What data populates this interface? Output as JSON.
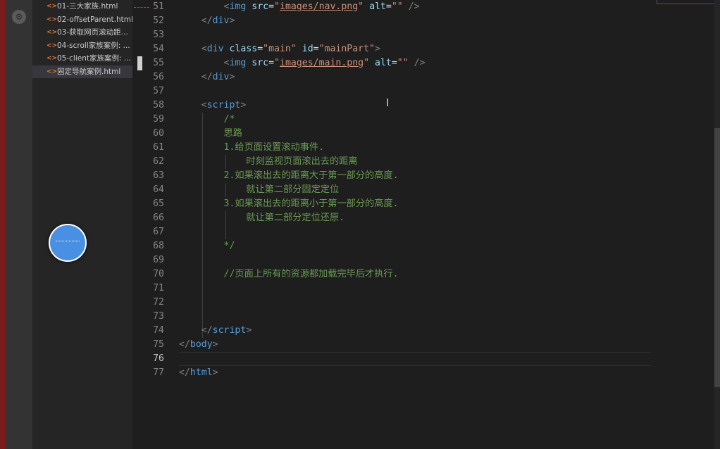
{
  "explorer": {
    "files": [
      {
        "icon": "<>",
        "name": "01-三大家族.html"
      },
      {
        "icon": "<>",
        "name": "02-offsetParent.html"
      },
      {
        "icon": "<>",
        "name": "03-获取网页滚动距..."
      },
      {
        "icon": "<>",
        "name": "04-scroll家族案例: ..."
      },
      {
        "icon": "<>",
        "name": "05-client家族案例: ..."
      },
      {
        "icon": "<>",
        "name": "固定导航案例.html",
        "active": true
      }
    ]
  },
  "editor": {
    "lines": [
      {
        "n": "51",
        "tokens": [
          [
            "",
            "        "
          ],
          [
            "bracket",
            "<"
          ],
          [
            "tag",
            "img"
          ],
          [
            "",
            " "
          ],
          [
            "attr",
            "src"
          ],
          [
            "",
            "="
          ],
          [
            "str",
            "\""
          ],
          [
            "str link",
            "images/nav.png"
          ],
          [
            "str",
            "\""
          ],
          [
            "",
            " "
          ],
          [
            "attr",
            "alt"
          ],
          [
            "",
            "="
          ],
          [
            "str",
            "\"\""
          ],
          [
            "",
            " "
          ],
          [
            "bracket",
            "/>"
          ]
        ]
      },
      {
        "n": "52",
        "tokens": [
          [
            "",
            "    "
          ],
          [
            "bracket",
            "</"
          ],
          [
            "tag",
            "div"
          ],
          [
            "bracket",
            ">"
          ]
        ]
      },
      {
        "n": "53",
        "tokens": []
      },
      {
        "n": "54",
        "tokens": [
          [
            "",
            "    "
          ],
          [
            "bracket",
            "<"
          ],
          [
            "tag",
            "div"
          ],
          [
            "",
            " "
          ],
          [
            "attr",
            "class"
          ],
          [
            "",
            "="
          ],
          [
            "str",
            "\"main\""
          ],
          [
            "",
            " "
          ],
          [
            "attr",
            "id"
          ],
          [
            "",
            "="
          ],
          [
            "str",
            "\"mainPart\""
          ],
          [
            "bracket",
            ">"
          ]
        ]
      },
      {
        "n": "55",
        "tokens": [
          [
            "",
            "        "
          ],
          [
            "bracket",
            "<"
          ],
          [
            "tag",
            "img"
          ],
          [
            "",
            " "
          ],
          [
            "attr",
            "src"
          ],
          [
            "",
            "="
          ],
          [
            "str",
            "\""
          ],
          [
            "str link",
            "images/main.png"
          ],
          [
            "str",
            "\""
          ],
          [
            "",
            " "
          ],
          [
            "attr",
            "alt"
          ],
          [
            "",
            "="
          ],
          [
            "str",
            "\"\""
          ],
          [
            "",
            " "
          ],
          [
            "bracket",
            "/>"
          ]
        ]
      },
      {
        "n": "56",
        "tokens": [
          [
            "",
            "    "
          ],
          [
            "bracket",
            "</"
          ],
          [
            "tag",
            "div"
          ],
          [
            "bracket",
            ">"
          ]
        ]
      },
      {
        "n": "57",
        "tokens": []
      },
      {
        "n": "58",
        "tokens": [
          [
            "",
            "    "
          ],
          [
            "bracket",
            "<"
          ],
          [
            "tag",
            "script"
          ],
          [
            "bracket",
            ">"
          ]
        ]
      },
      {
        "n": "59",
        "tokens": [
          [
            "",
            "        "
          ],
          [
            "cmt",
            "/*"
          ]
        ]
      },
      {
        "n": "60",
        "tokens": [
          [
            "",
            "        "
          ],
          [
            "cmt",
            "思路"
          ]
        ]
      },
      {
        "n": "61",
        "tokens": [
          [
            "",
            "        "
          ],
          [
            "cmt",
            "1.给页面设置滚动事件."
          ]
        ]
      },
      {
        "n": "62",
        "tokens": [
          [
            "",
            "            "
          ],
          [
            "cmt",
            "时刻监视页面滚出去的距离"
          ]
        ]
      },
      {
        "n": "63",
        "tokens": [
          [
            "",
            "        "
          ],
          [
            "cmt",
            "2.如果滚出去的距离大于第一部分的高度."
          ]
        ]
      },
      {
        "n": "64",
        "tokens": [
          [
            "",
            "            "
          ],
          [
            "cmt",
            "就让第二部分固定定位"
          ]
        ]
      },
      {
        "n": "65",
        "tokens": [
          [
            "",
            "        "
          ],
          [
            "cmt",
            "3.如果滚出去的距离小于第一部分的高度."
          ]
        ]
      },
      {
        "n": "66",
        "tokens": [
          [
            "",
            "            "
          ],
          [
            "cmt",
            "就让第二部分定位还原."
          ]
        ]
      },
      {
        "n": "67",
        "tokens": []
      },
      {
        "n": "68",
        "tokens": [
          [
            "",
            "        "
          ],
          [
            "cmt",
            "*/"
          ]
        ]
      },
      {
        "n": "69",
        "tokens": []
      },
      {
        "n": "70",
        "tokens": [
          [
            "",
            "        "
          ],
          [
            "cmt",
            "//页面上所有的资源都加载完毕后才执行."
          ]
        ]
      },
      {
        "n": "71",
        "tokens": []
      },
      {
        "n": "72",
        "tokens": []
      },
      {
        "n": "73",
        "tokens": []
      },
      {
        "n": "74",
        "tokens": [
          [
            "",
            "    "
          ],
          [
            "bracket",
            "</"
          ],
          [
            "tag",
            "script"
          ],
          [
            "bracket",
            ">"
          ]
        ]
      },
      {
        "n": "75",
        "tokens": [
          [
            "bracket",
            "</"
          ],
          [
            "tag",
            "body"
          ],
          [
            "bracket",
            ">"
          ]
        ]
      },
      {
        "n": "76",
        "current": true,
        "tokens": []
      },
      {
        "n": "77",
        "tokens": [
          [
            "bracket",
            "</"
          ],
          [
            "tag",
            "html"
          ],
          [
            "bracket",
            ">"
          ]
        ]
      }
    ]
  },
  "colors": {
    "editor_bg": "#1e1e1e",
    "sidebar_bg": "#252526",
    "comment": "#6a9955",
    "tag": "#569cd6",
    "attribute": "#9cdcfe",
    "string": "#ce9178"
  },
  "icons": {
    "activity": "settings-circle-icon",
    "file": "html-file-icon",
    "cursor": "text-cursor-icon",
    "floating": "floating-assistant-icon"
  }
}
